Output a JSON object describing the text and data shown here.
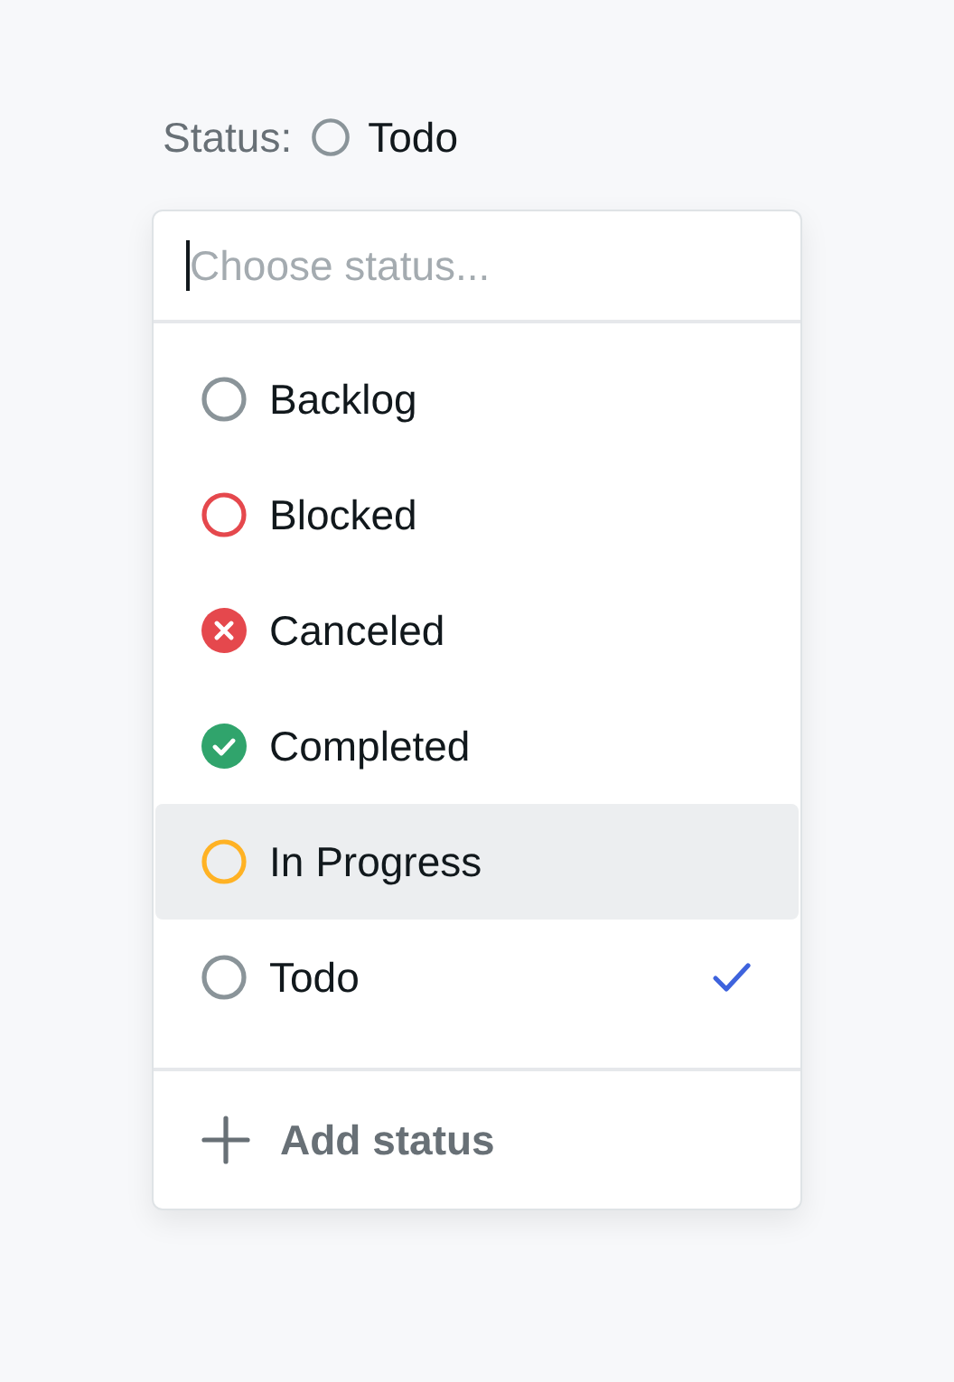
{
  "status": {
    "label": "Status:",
    "current": {
      "label": "Todo",
      "kind": "ring",
      "color": "#8a9499"
    }
  },
  "search": {
    "placeholder": "Choose status..."
  },
  "items": [
    {
      "label": "Backlog",
      "kind": "ring",
      "color": "#8a9499",
      "highlighted": false,
      "selected": false
    },
    {
      "label": "Blocked",
      "kind": "ring",
      "color": "#e5484d",
      "highlighted": false,
      "selected": false
    },
    {
      "label": "Canceled",
      "kind": "cross",
      "color": "#e5484d",
      "highlighted": false,
      "selected": false
    },
    {
      "label": "Completed",
      "kind": "check",
      "color": "#30a46c",
      "highlighted": false,
      "selected": false
    },
    {
      "label": "In Progress",
      "kind": "ring",
      "color": "#ffb224",
      "highlighted": true,
      "selected": false
    },
    {
      "label": "Todo",
      "kind": "ring",
      "color": "#8a9499",
      "highlighted": false,
      "selected": true
    }
  ],
  "add_button": {
    "label": "Add status"
  }
}
